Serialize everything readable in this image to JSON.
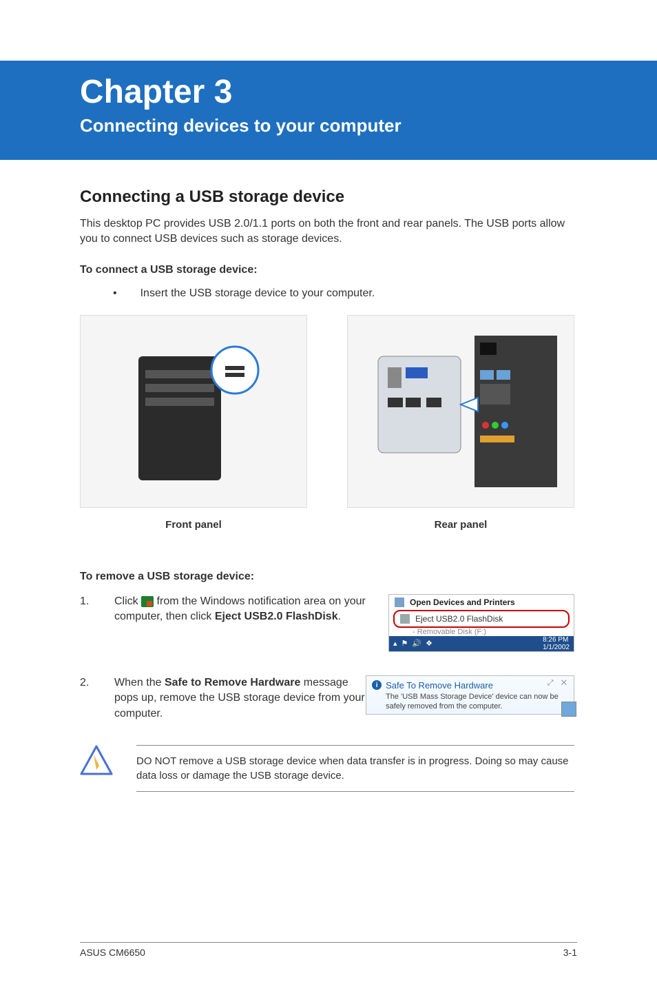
{
  "chapter": {
    "title": "Chapter 3",
    "subtitle": "Connecting devices to your computer"
  },
  "section": {
    "heading": "Connecting a USB storage device",
    "intro": "This desktop PC provides USB 2.0/1.1 ports on both the front and rear panels. The USB ports allow you to connect USB devices such as storage devices.",
    "connect_heading": "To connect a USB storage device:",
    "connect_bullet": "Insert the USB storage device to your computer.",
    "front_caption": "Front panel",
    "rear_caption": "Rear panel",
    "remove_heading": "To remove a USB storage device:",
    "steps": [
      {
        "num": "1.",
        "pre": "Click ",
        "post1": " from the Windows notification area on your computer, then click ",
        "bold": "Eject USB2.0 FlashDisk",
        "post2": "."
      },
      {
        "num": "2.",
        "pre": "When the ",
        "bold": "Safe to Remove Hardware",
        "post": " message pops up, remove the USB storage device from your computer."
      }
    ]
  },
  "screenshot1": {
    "row1": "Open Devices and Printers",
    "row2": "Eject USB2.0 FlashDisk",
    "sub": "-   Removable Disk (F:)",
    "tray_time": "8:26 PM",
    "tray_date": "1/1/2002"
  },
  "screenshot2": {
    "title": "Safe To Remove Hardware",
    "body": "The 'USB Mass Storage Device' device can now be safely removed from the computer.",
    "close_glyphs": "⤢ ✕"
  },
  "warning": {
    "text": "DO NOT remove a USB storage device when data transfer is in progress. Doing so may cause data loss or damage the USB storage device."
  },
  "footer": {
    "left": "ASUS CM6650",
    "right": "3-1"
  }
}
